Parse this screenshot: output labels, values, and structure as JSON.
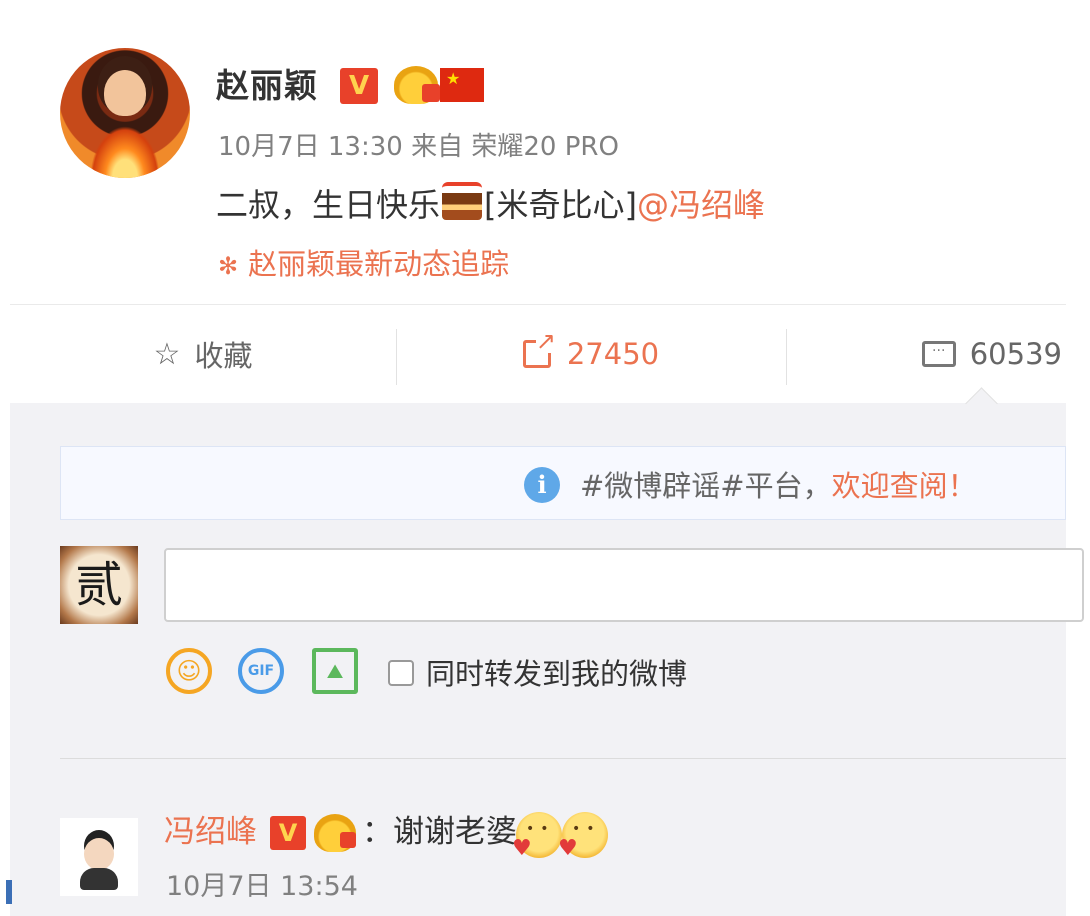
{
  "post": {
    "author": "赵丽颖",
    "verified_badge": "V",
    "meta": "10月7日 13:30 来自 荣耀20 PRO",
    "text_before_emoji": "二叔，生日快乐",
    "emoji_name": "cake-emoji",
    "text_after_emoji": "[米奇比心]",
    "mention": "@冯绍峰",
    "tracker_icon": "✻",
    "tracker_label": "赵丽颖最新动态追踪"
  },
  "actions": {
    "favorite_icon": "☆",
    "favorite_label": "收藏",
    "repost_count": "27450",
    "comment_count": "60539"
  },
  "notice": {
    "icon": "i",
    "text": "#微博辟谣#平台，",
    "link": "欢迎查阅！"
  },
  "composer": {
    "avatar_char": "贰",
    "input_value": "",
    "input_placeholder": "",
    "emoji_tool": "☺",
    "gif_tool": "GIF",
    "image_tool": "⛰",
    "checkbox_label": "同时转发到我的微博"
  },
  "reply": {
    "author": "冯绍峰",
    "verified_badge": "V",
    "text": "：谢谢老婆",
    "time": "10月7日 13:54"
  },
  "colors": {
    "accent": "#eb7350",
    "verified": "#e8412a",
    "panel_bg": "#f2f2f5"
  }
}
